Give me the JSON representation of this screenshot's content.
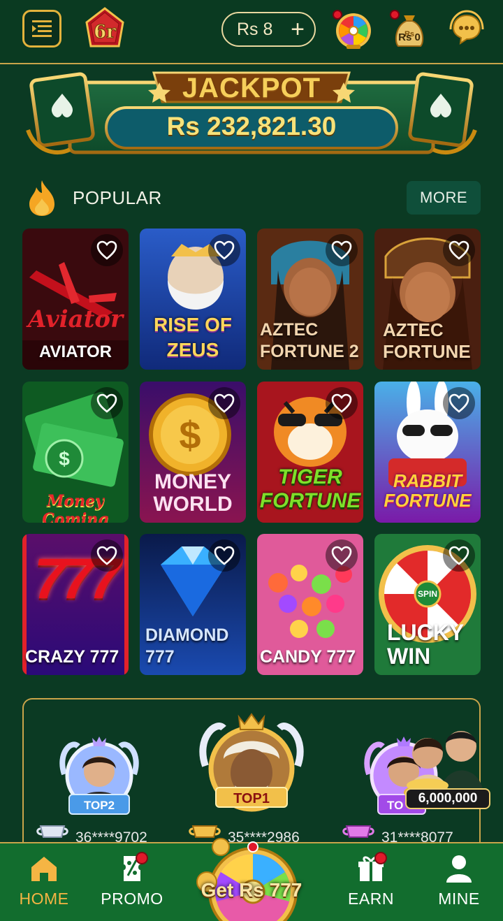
{
  "header": {
    "balance": "Rs 8",
    "plus": "+",
    "bag_amount": "Rs 0"
  },
  "jackpot": {
    "title": "JACKPOT",
    "amount": "Rs 232,821.30"
  },
  "popular": {
    "title": "POPULAR",
    "more": "MORE",
    "games": [
      {
        "name": "AVIATOR",
        "art_text": "Aviator"
      },
      {
        "name": "RISE OF\nZEUS",
        "art_text": ""
      },
      {
        "name": "AZTEC\nFORTUNE 2",
        "art_text": ""
      },
      {
        "name": "AZTEC\nFORTUNE",
        "art_text": ""
      },
      {
        "name": "",
        "art_text": "Money Coming"
      },
      {
        "name": "MONEY\nWORLD",
        "art_text": ""
      },
      {
        "name": "",
        "art_text": "TIGER\nFORTUNE"
      },
      {
        "name": "",
        "art_text": "RABBIT\nFORTUNE"
      },
      {
        "name": "CRAZY 777",
        "art_text": "777"
      },
      {
        "name": "DIAMOND\n777",
        "art_text": ""
      },
      {
        "name": "CANDY 777",
        "art_text": ""
      },
      {
        "name": "LUCKY\nWIN",
        "art_text": "SPIN"
      }
    ]
  },
  "leaderboard": {
    "players": [
      {
        "rank": "TOP2",
        "id": "36****9702"
      },
      {
        "rank": "TOP1",
        "id": "35****2986"
      },
      {
        "rank": "TO",
        "id": "31****8077"
      }
    ],
    "promo_amount": "6,000,000"
  },
  "nav": {
    "home": "HOME",
    "promo": "PROMO",
    "center": "Get Rs 777",
    "earn": "EARN",
    "mine": "MINE"
  },
  "colors": {
    "background": "#0b3a23",
    "nav_bg": "#126d2e",
    "gold": "#c9a44a",
    "active": "#f5b544"
  }
}
